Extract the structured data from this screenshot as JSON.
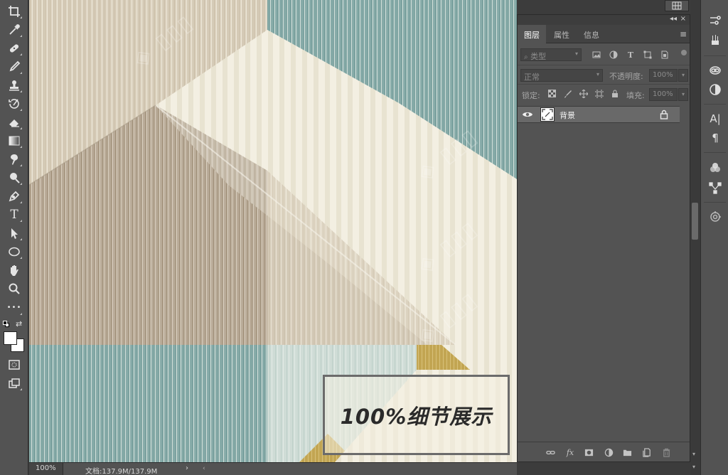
{
  "toolbar": {
    "tools": [
      {
        "name": "crop-tool",
        "icon": "crop-icon"
      },
      {
        "name": "eyedropper-tool",
        "icon": "eyedropper-icon"
      },
      {
        "name": "healing-brush-tool",
        "icon": "bandage-icon"
      },
      {
        "name": "brush-tool",
        "icon": "brush-icon"
      },
      {
        "name": "clone-stamp-tool",
        "icon": "stamp-icon"
      },
      {
        "name": "history-brush-tool",
        "icon": "history-brush-icon"
      },
      {
        "name": "eraser-tool",
        "icon": "eraser-icon"
      },
      {
        "name": "gradient-tool",
        "icon": "gradient-icon"
      },
      {
        "name": "smudge-tool",
        "icon": "smudge-icon"
      },
      {
        "name": "dodge-tool",
        "icon": "dodge-icon"
      },
      {
        "name": "pen-tool",
        "icon": "pen-icon"
      },
      {
        "name": "type-tool",
        "icon": "type-icon",
        "glyph": "T"
      },
      {
        "name": "path-selection-tool",
        "icon": "arrow-cursor-icon"
      },
      {
        "name": "ellipse-tool",
        "icon": "ellipse-icon"
      },
      {
        "name": "hand-tool",
        "icon": "hand-icon"
      },
      {
        "name": "zoom-tool",
        "icon": "magnifier-icon"
      },
      {
        "name": "more-tools",
        "icon": "ellipsis-icon",
        "glyph": "•••"
      }
    ],
    "foreground_color": "#ffffff",
    "background_color": "#ffffff"
  },
  "canvas": {
    "overlay_caption": "100%细节展示",
    "colors": {
      "teal": "#7fa3a3",
      "beige": "#d8cdb8",
      "taupe": "#b4a592",
      "cream": "#f0ecdd",
      "mustard": "#c2a552"
    }
  },
  "status_bar": {
    "zoom": "100%",
    "doc_info": "文档:137.9M/137.9M",
    "arrow": "›"
  },
  "layers_panel": {
    "collapse_glyph": "◂◂",
    "close_glyph": "×",
    "tabs": [
      {
        "label": "图层",
        "active": true
      },
      {
        "label": "属性",
        "active": false
      },
      {
        "label": "信息",
        "active": false
      }
    ],
    "menu_glyph": "≡",
    "filter": {
      "label": "类型",
      "icon": "search-icon"
    },
    "blend_mode": "正常",
    "opacity_label": "不透明度:",
    "opacity_value": "100%",
    "lock_label": "锁定:",
    "fill_label": "填充:",
    "fill_value": "100%",
    "layers": [
      {
        "name": "背景",
        "visible": true,
        "locked": true
      }
    ]
  },
  "dock": {
    "panels": [
      "brush-settings-icon",
      "brushes-icon",
      "libraries-icon",
      "adjustments-icon",
      "character-icon",
      "paragraph-icon",
      "channels-icon",
      "paths-icon",
      "clone-source-icon"
    ],
    "character_glyph": "A|",
    "paragraph_glyph": "¶"
  }
}
